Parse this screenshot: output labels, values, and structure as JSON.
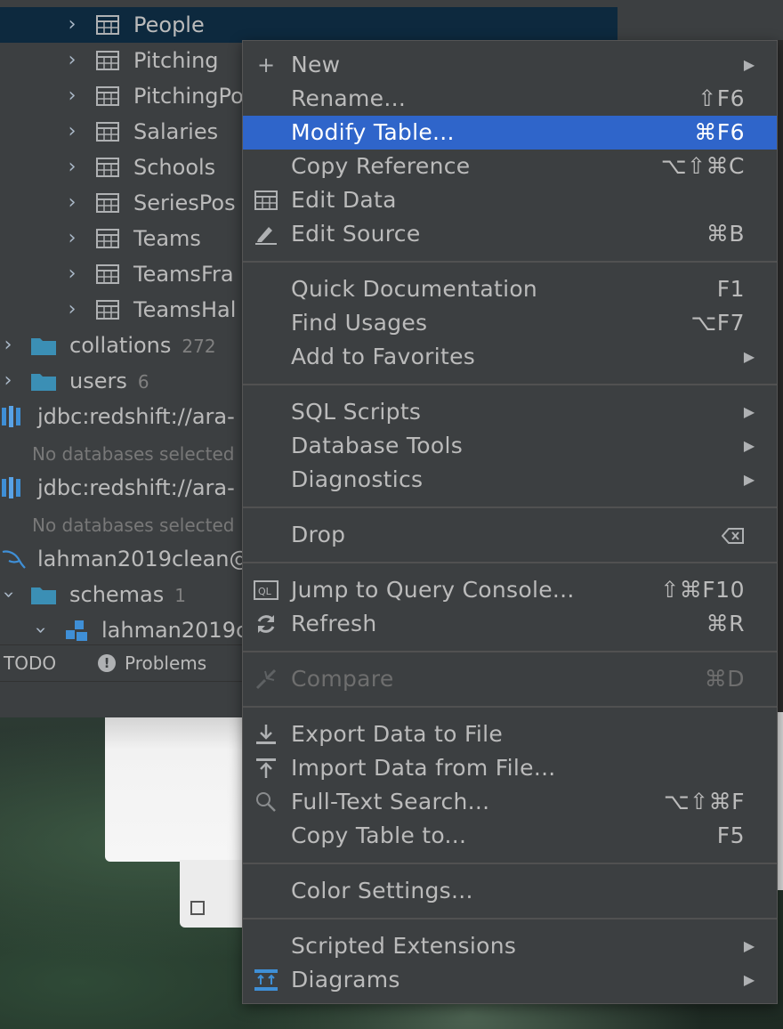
{
  "tree": {
    "tables": [
      {
        "label": "People",
        "selected": true
      },
      {
        "label": "Pitching"
      },
      {
        "label": "PitchingPo"
      },
      {
        "label": "Salaries"
      },
      {
        "label": "Schools"
      },
      {
        "label": "SeriesPos"
      },
      {
        "label": "Teams"
      },
      {
        "label": "TeamsFra"
      },
      {
        "label": "TeamsHal"
      }
    ],
    "collations": {
      "label": "collations",
      "count": "272"
    },
    "users": {
      "label": "users",
      "count": "6"
    },
    "conn1": {
      "label": "jdbc:redshift://ara-",
      "msg": "No databases selected"
    },
    "conn2": {
      "label": "jdbc:redshift://ara-",
      "msg": "No databases selected"
    },
    "conn3": {
      "label": "lahman2019clean@"
    },
    "schemas": {
      "label": "schemas",
      "count": "1"
    },
    "schema": {
      "label": "lahman2019c"
    }
  },
  "bottom": {
    "todo": "TODO",
    "problems": "Problems"
  },
  "menu": {
    "new": {
      "label": "New"
    },
    "rename": {
      "label": "Rename...",
      "shortcut": "⇧F6"
    },
    "modify": {
      "label": "Modify Table...",
      "shortcut": "⌘F6"
    },
    "copy_ref": {
      "label": "Copy Reference",
      "shortcut": "⌥⇧⌘C"
    },
    "edit_data": {
      "label": "Edit Data"
    },
    "edit_source": {
      "label": "Edit Source",
      "shortcut": "⌘B"
    },
    "quick_doc": {
      "label": "Quick Documentation",
      "shortcut": "F1"
    },
    "find_usages": {
      "label": "Find Usages",
      "shortcut": "⌥F7"
    },
    "add_fav": {
      "label": "Add to Favorites"
    },
    "sql_scripts": {
      "label": "SQL Scripts"
    },
    "db_tools": {
      "label": "Database Tools"
    },
    "diagnostics": {
      "label": "Diagnostics"
    },
    "drop": {
      "label": "Drop"
    },
    "jump_console": {
      "label": "Jump to Query Console...",
      "shortcut": "⇧⌘F10"
    },
    "refresh": {
      "label": "Refresh",
      "shortcut": "⌘R"
    },
    "compare": {
      "label": "Compare",
      "shortcut": "⌘D"
    },
    "export": {
      "label": "Export Data to File"
    },
    "import": {
      "label": "Import Data from File..."
    },
    "fulltext": {
      "label": "Full-Text Search...",
      "shortcut": "⌥⇧⌘F"
    },
    "copy_table": {
      "label": "Copy Table to...",
      "shortcut": "F5"
    },
    "color_settings": {
      "label": "Color Settings..."
    },
    "scripted_ext": {
      "label": "Scripted Extensions"
    },
    "diagrams": {
      "label": "Diagrams"
    },
    "icons_ql": "QL"
  },
  "colors": {
    "selection": "#2f65ca",
    "tree_selection": "#0d293e",
    "folder": "#3b8fb5",
    "datasource": "#3f8fd6"
  }
}
